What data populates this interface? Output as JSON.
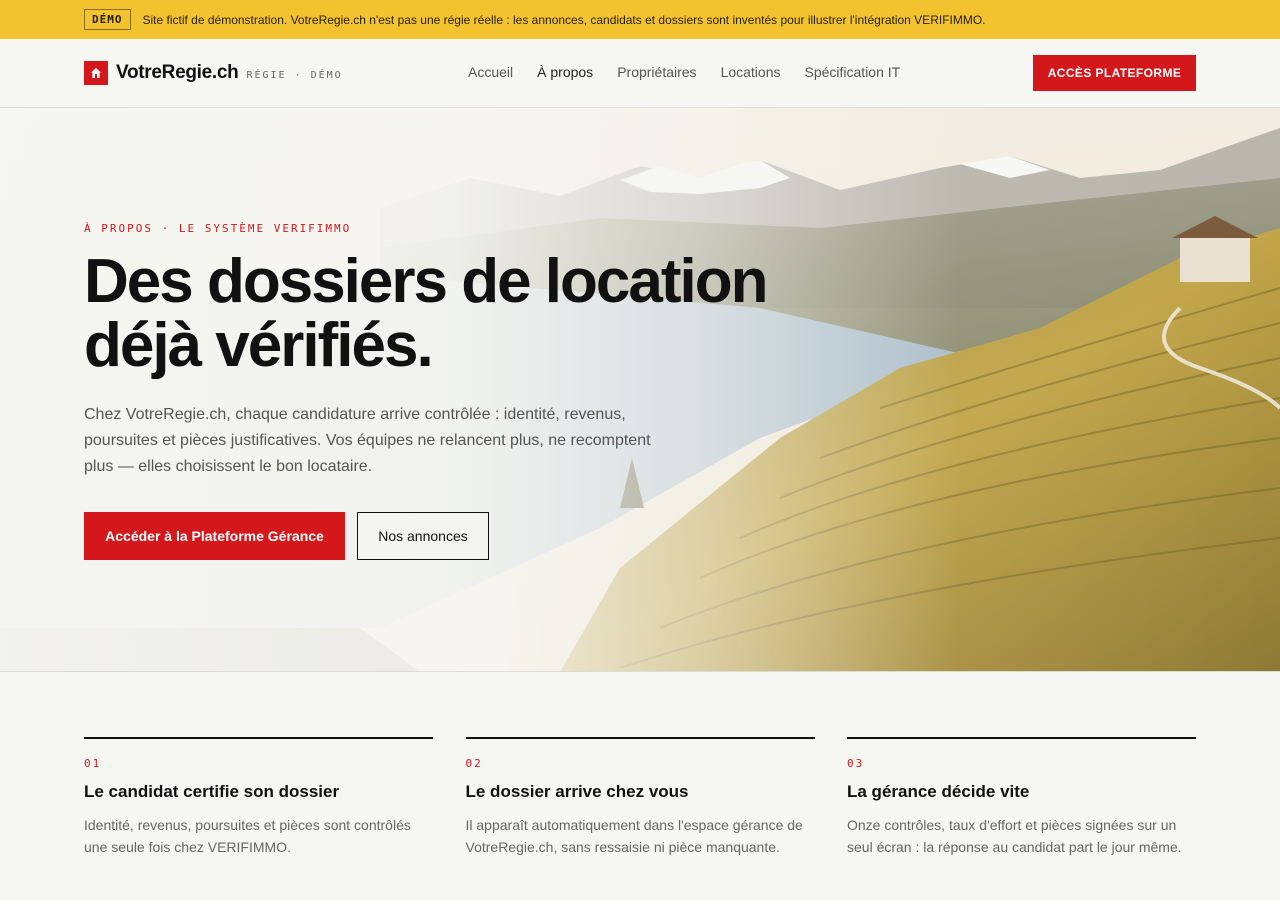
{
  "banner": {
    "badge": "DÉMO",
    "text": "Site fictif de démonstration. VotreRegie.ch n'est pas une régie réelle : les annonces, candidats et dossiers sont inventés pour illustrer l'intégration VERIFIMMO."
  },
  "header": {
    "brand_name": "VotreRegie.ch",
    "brand_sub": "RÉGIE · DÉMO",
    "logo_icon": "house-icon",
    "nav": [
      {
        "label": "Accueil"
      },
      {
        "label": "À propos"
      },
      {
        "label": "Propriétaires"
      },
      {
        "label": "Locations"
      },
      {
        "label": "Spécification IT"
      }
    ],
    "cta_label": "ACCÈS PLATEFORME"
  },
  "hero": {
    "eyebrow": "À PROPOS · LE SYSTÈME VERIFIMMO",
    "title_line1": "Des dossiers de location",
    "title_line2": "déjà vérifiés.",
    "text": "Chez VotreRegie.ch, chaque candidature arrive contrôlée : identité, revenus, poursuites et pièces justificatives. Vos équipes ne relancent plus, ne recomptent plus — elles choisissent le bon locataire.",
    "primary_button": "Accéder à la Plateforme Gérance",
    "secondary_button": "Nos annonces"
  },
  "steps": [
    {
      "num": "01",
      "title": "Le candidat certifie son dossier",
      "text": "Identité, revenus, poursuites et pièces sont contrôlés une seule fois chez VERIFIMMO."
    },
    {
      "num": "02",
      "title": "Le dossier arrive chez vous",
      "text": "Il apparaît automatiquement dans l'espace gérance de VotreRegie.ch, sans ressaisie ni pièce manquante."
    },
    {
      "num": "03",
      "title": "La gérance décide vite",
      "text": "Onze contrôles, taux d'effort et pièces signées sur un seul écran : la réponse au candidat part le jour même."
    }
  ],
  "colors": {
    "accent": "#d3171b",
    "banner": "#f3c22f",
    "background": "#f6f6f2"
  }
}
